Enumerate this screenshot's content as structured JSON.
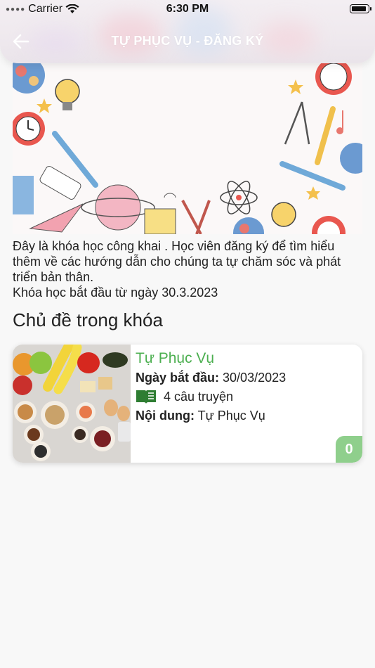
{
  "status_bar": {
    "carrier": "Carrier",
    "time": "6:30 PM"
  },
  "header": {
    "title": "TỰ PHỤC VỤ - ĐĂNG KÝ",
    "back_icon": "arrow-left-icon"
  },
  "description": {
    "line1": "Đây là khóa học công khai . Học viên đăng ký để tìm hiểu thêm về các hướng dẫn cho chúng ta tự chăm sóc và phát triển bản thân.",
    "line2": "Khóa học bắt đầu từ ngày 30.3.2023"
  },
  "section": {
    "title": "Chủ đề trong khóa"
  },
  "topics": [
    {
      "name": "Tự Phục Vụ",
      "start_label": "Ngày bắt đầu:",
      "start_value": "30/03/2023",
      "stories_icon": "book-icon",
      "stories": "4 câu truyện",
      "content_label": "Nội dung:",
      "content_value": "Tự Phục Vụ",
      "badge": "0"
    }
  ],
  "colors": {
    "accent_green": "#4caf50",
    "badge_green": "#8fcf8c"
  }
}
